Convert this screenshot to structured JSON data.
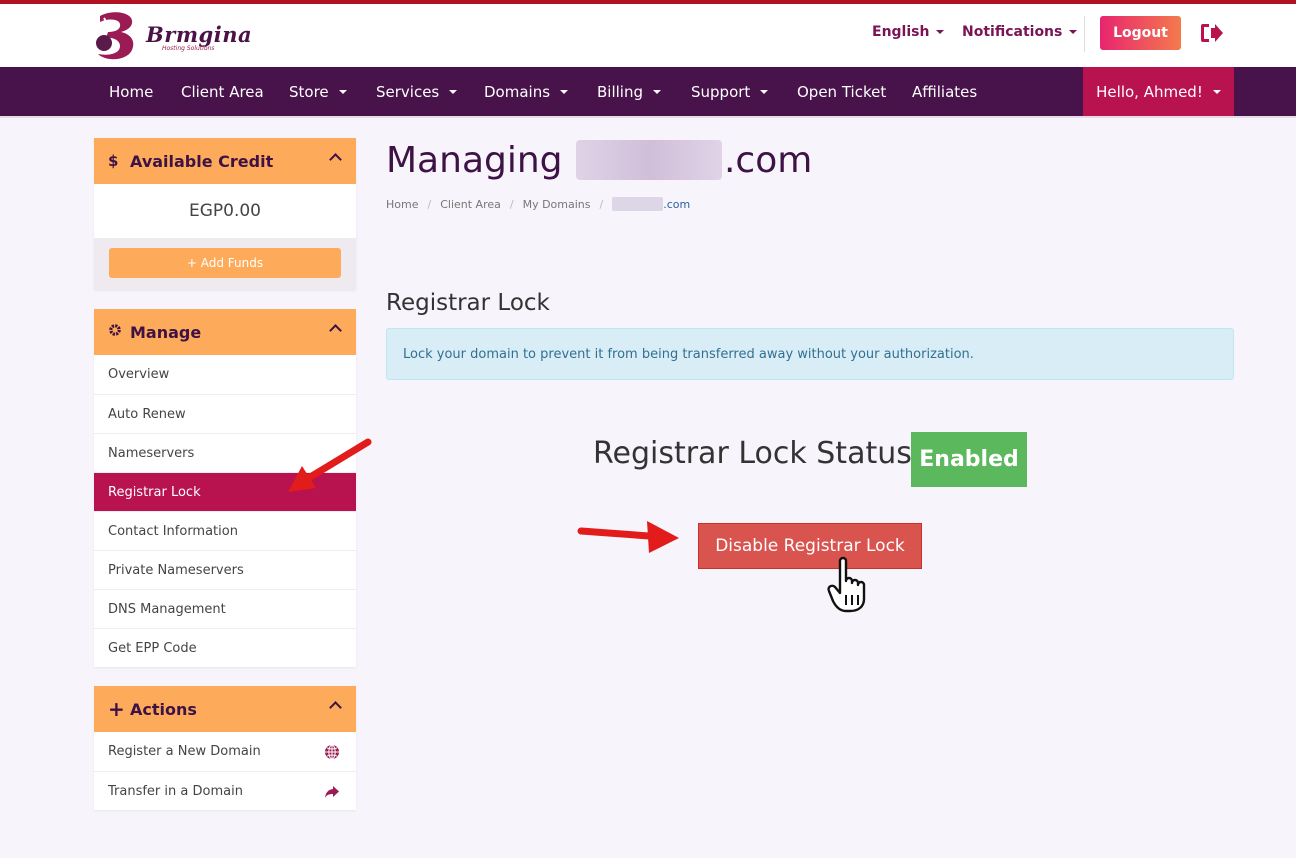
{
  "header": {
    "logo_text": "Brmgina",
    "logo_subtext": "Hosting Solutions",
    "language_label": "English",
    "notifications_label": "Notifications",
    "logout_label": "Logout"
  },
  "nav": {
    "items": [
      {
        "label": "Home"
      },
      {
        "label": "Client Area"
      },
      {
        "label": "Store"
      },
      {
        "label": "Services"
      },
      {
        "label": "Domains"
      },
      {
        "label": "Billing"
      },
      {
        "label": "Support"
      },
      {
        "label": "Open Ticket"
      },
      {
        "label": "Affiliates"
      }
    ],
    "user_greeting": "Hello, Ahmed!"
  },
  "sidebar": {
    "credit": {
      "icon": "dollar-icon",
      "icon_glyph": "$",
      "title": "Available Credit",
      "amount": "EGP0.00",
      "add_funds_label": "+ Add Funds"
    },
    "manage": {
      "icon": "gear-icon",
      "title": "Manage",
      "items": [
        {
          "label": "Overview"
        },
        {
          "label": "Auto Renew"
        },
        {
          "label": "Nameservers"
        },
        {
          "label": "Registrar Lock",
          "active": true
        },
        {
          "label": "Contact Information"
        },
        {
          "label": "Private Nameservers"
        },
        {
          "label": "DNS Management"
        },
        {
          "label": "Get EPP Code"
        }
      ]
    },
    "actions": {
      "icon": "plus-icon",
      "icon_glyph": "+",
      "title": "Actions",
      "items": [
        {
          "label": "Register a New Domain",
          "icon": "globe-icon"
        },
        {
          "label": "Transfer in a Domain",
          "icon": "share-arrow-icon"
        }
      ]
    }
  },
  "main": {
    "title_prefix": "Managing",
    "title_suffix": ".com",
    "breadcrumb": [
      "Home",
      "Client Area",
      "My Domains"
    ],
    "breadcrumb_current_suffix": ".com",
    "section_title": "Registrar Lock",
    "info_text": "Lock your domain to prevent it from being transferred away without your authorization.",
    "status_label": "Registrar Lock Status:",
    "status_value": "Enabled",
    "disable_button_label": "Disable Registrar Lock"
  },
  "colors": {
    "brand_dark": "#48124a",
    "brand_pink": "#b8124f",
    "accent_orange": "#fdab5a",
    "success": "#5cb85c",
    "danger": "#d9534f",
    "info_bg": "#d9edf7"
  }
}
